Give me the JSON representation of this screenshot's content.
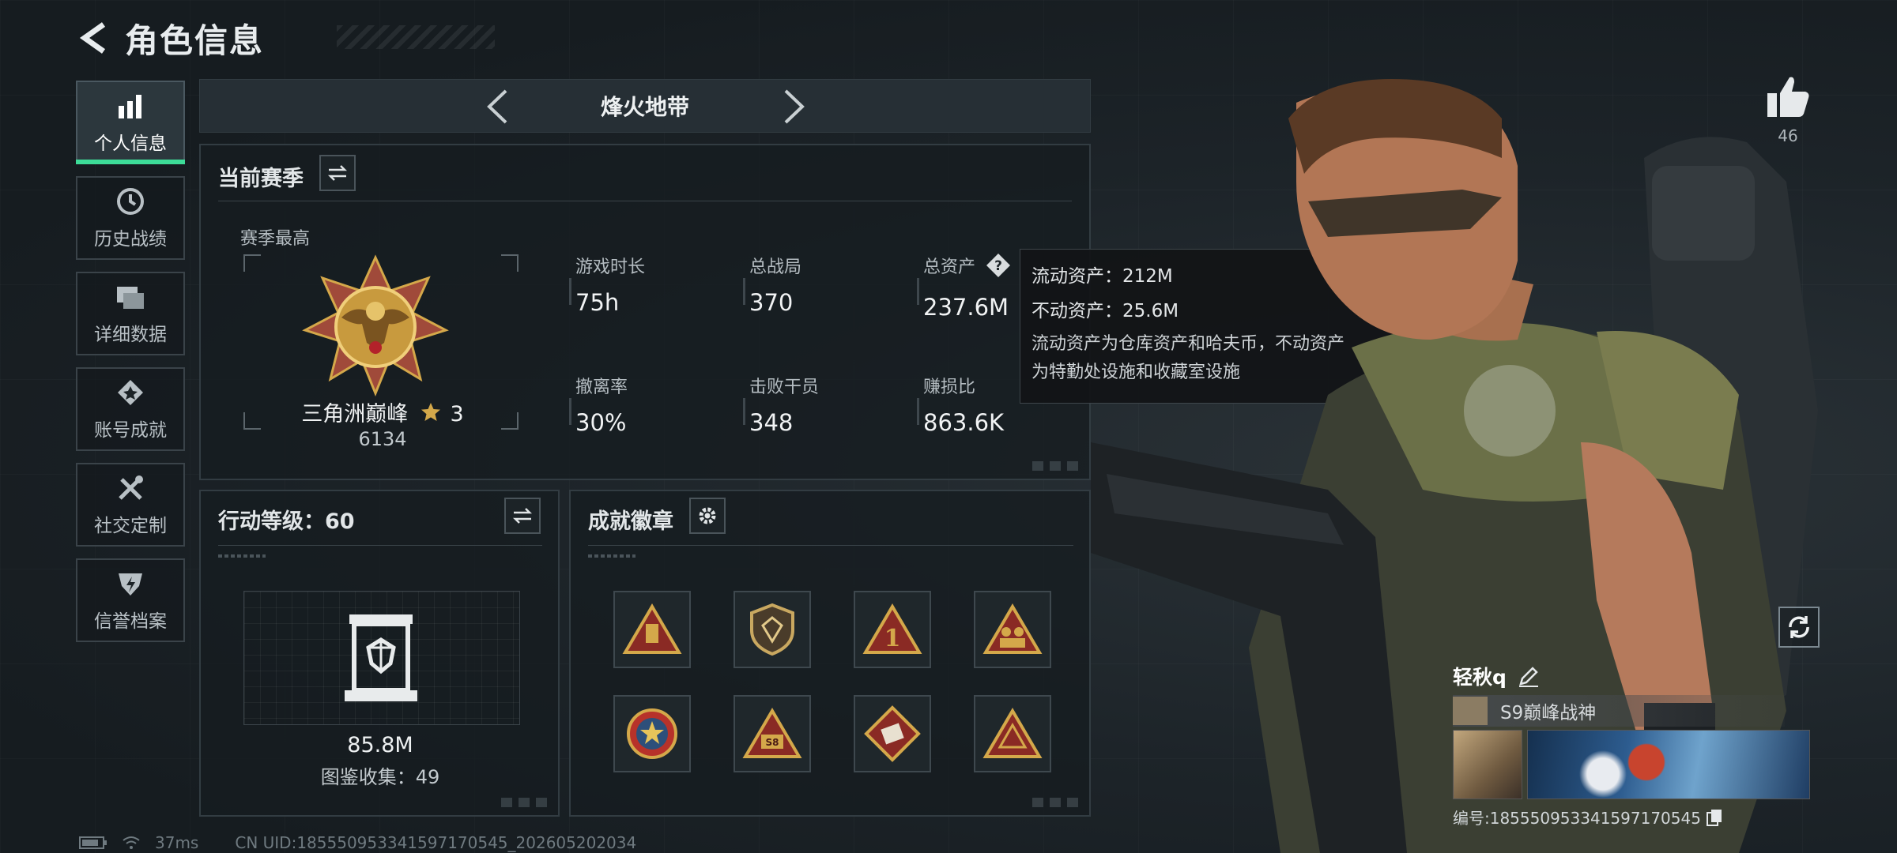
{
  "header": {
    "title": "角色信息"
  },
  "sidebar": {
    "items": [
      {
        "label": "个人信息",
        "icon": "bar-chart-icon",
        "active": true
      },
      {
        "label": "历史战绩",
        "icon": "history-icon",
        "active": false
      },
      {
        "label": "详细数据",
        "icon": "folder-icon",
        "active": false
      },
      {
        "label": "账号成就",
        "icon": "achievement-icon",
        "active": false
      },
      {
        "label": "社交定制",
        "icon": "tools-icon",
        "active": false
      },
      {
        "label": "信誉档案",
        "icon": "credit-icon",
        "active": false
      }
    ]
  },
  "mode": {
    "title": "烽火地带"
  },
  "season": {
    "title": "当前赛季",
    "subtitle": "赛季最高",
    "rank_name": "三角洲巅峰",
    "rank_stars": "3",
    "rank_score": "6134",
    "stats": [
      {
        "label": "游戏时长",
        "value": "75h"
      },
      {
        "label": "总战局",
        "value": "370"
      },
      {
        "label": "总资产",
        "value": "237.6M"
      },
      {
        "label": "撤离率",
        "value": "30%"
      },
      {
        "label": "击败干员",
        "value": "348"
      },
      {
        "label": "赚损比",
        "value": "863.6K"
      }
    ]
  },
  "tooltip": {
    "line1": "流动资产：212M",
    "line2": "不动资产：25.6M",
    "desc1": "流动资产为仓库资产和哈夫币，不动资产",
    "desc2": "为特勤处设施和收藏室设施"
  },
  "level": {
    "title": "行动等级：60",
    "codex_value": "85.8M",
    "codex_count": "图鉴收集：49"
  },
  "achievements": {
    "title": "成就徽章"
  },
  "profile": {
    "likes": "46",
    "name": "轻秋q",
    "title": "S9巅峰战神",
    "uid": "编号:185550953341597170545"
  },
  "status": {
    "ping": "37ms",
    "uid": "CN UID:185550953341597170545_202605202034"
  },
  "colors": {
    "accent": "#3ddc98",
    "gold": "#d4a84a"
  }
}
